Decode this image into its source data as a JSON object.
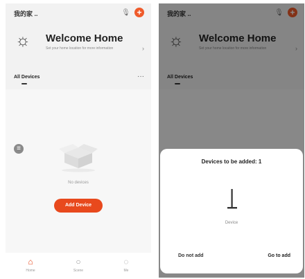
{
  "left_screen": {
    "topbar": {
      "home_title": "我的家 ..",
      "mic_icon": "mic-icon",
      "plus_icon": "plus-icon",
      "plus_symbol": "+"
    },
    "weather": {
      "icon": "sun-icon",
      "icon_glyph": "☼",
      "title": "Welcome Home",
      "subtitle": "Set your home location for more information",
      "arrow_glyph": "›"
    },
    "tabs": {
      "all_devices": "All Devices",
      "more": "···"
    },
    "empty": {
      "text": "No devices",
      "add_button": "Add Device"
    },
    "side_button_glyph": "≡",
    "nav": [
      {
        "label": "Home",
        "icon": "home-icon",
        "glyph": "⌂",
        "color": "#e8491d"
      },
      {
        "label": "Scene",
        "icon": "scene-icon",
        "glyph": "○",
        "color": "#999999"
      },
      {
        "label": "Me",
        "icon": "me-icon",
        "glyph": "◌",
        "color": "#999999"
      }
    ]
  },
  "right_screen": {
    "topbar": {
      "home_title": "我的家 .."
    },
    "weather": {
      "title": "Welcome Home",
      "subtitle": "Set your home location for more information"
    },
    "tabs": {
      "all_devices": "All Devices"
    },
    "dialog": {
      "title": "Devices to be added: 1",
      "device_name": "Device",
      "cancel_button": "Do not add",
      "confirm_button": "Go to add"
    }
  },
  "colors": {
    "accent": "#e8491d",
    "background": "#f2f2f2",
    "overlay": "rgba(0,0,0,0.45)"
  }
}
